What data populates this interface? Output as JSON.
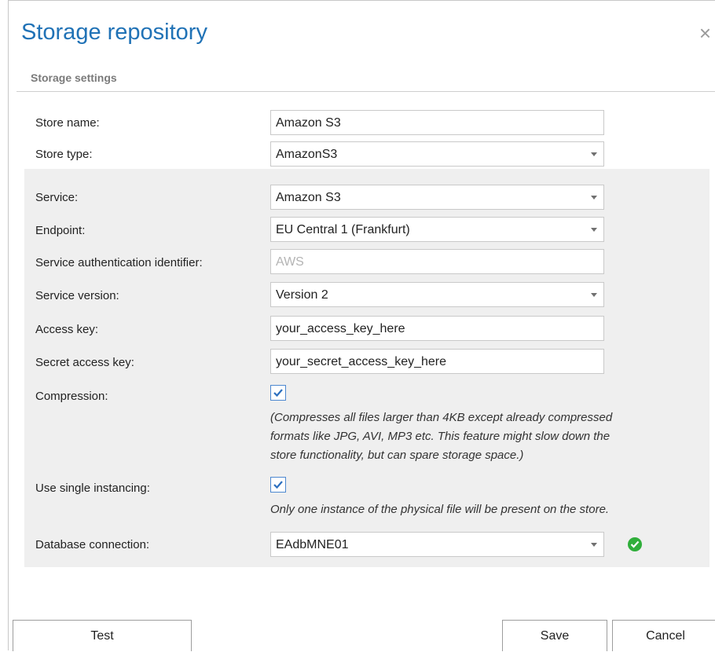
{
  "dialog": {
    "title": "Storage repository",
    "close_glyph": "×",
    "section": "Storage settings"
  },
  "fields": {
    "store_name": {
      "label": "Store name:",
      "value": "Amazon S3"
    },
    "store_type": {
      "label": "Store type:",
      "value": "AmazonS3"
    },
    "service": {
      "label": "Service:",
      "value": "Amazon S3"
    },
    "endpoint": {
      "label": "Endpoint:",
      "value": "EU Central 1 (Frankfurt)"
    },
    "service_auth": {
      "label": "Service authentication identifier:",
      "value": "AWS"
    },
    "service_version": {
      "label": "Service version:",
      "value": "Version 2"
    },
    "access_key": {
      "label": "Access key:",
      "value": "your_access_key_here"
    },
    "secret_key": {
      "label": "Secret access key:",
      "value": "your_secret_access_key_here"
    },
    "compression": {
      "label": "Compression:",
      "checked": true,
      "note_line1": "(Compresses all files larger than 4KB except already compressed",
      "note_line2": "formats like JPG, AVI, MP3 etc. This feature might slow down the",
      "note_line3": "store functionality, but can spare storage space.)"
    },
    "single_instancing": {
      "label": "Use single instancing:",
      "checked": true,
      "note": "Only one instance of the physical file will be present on the store."
    },
    "database_connection": {
      "label": "Database connection:",
      "value": "EAdbMNE01",
      "status_icon": "check-circle-icon"
    }
  },
  "buttons": {
    "test": "Test",
    "save": "Save",
    "cancel": "Cancel"
  },
  "colors": {
    "title": "#2072b6",
    "panel": "#efefef",
    "ok": "#2fae3a"
  }
}
